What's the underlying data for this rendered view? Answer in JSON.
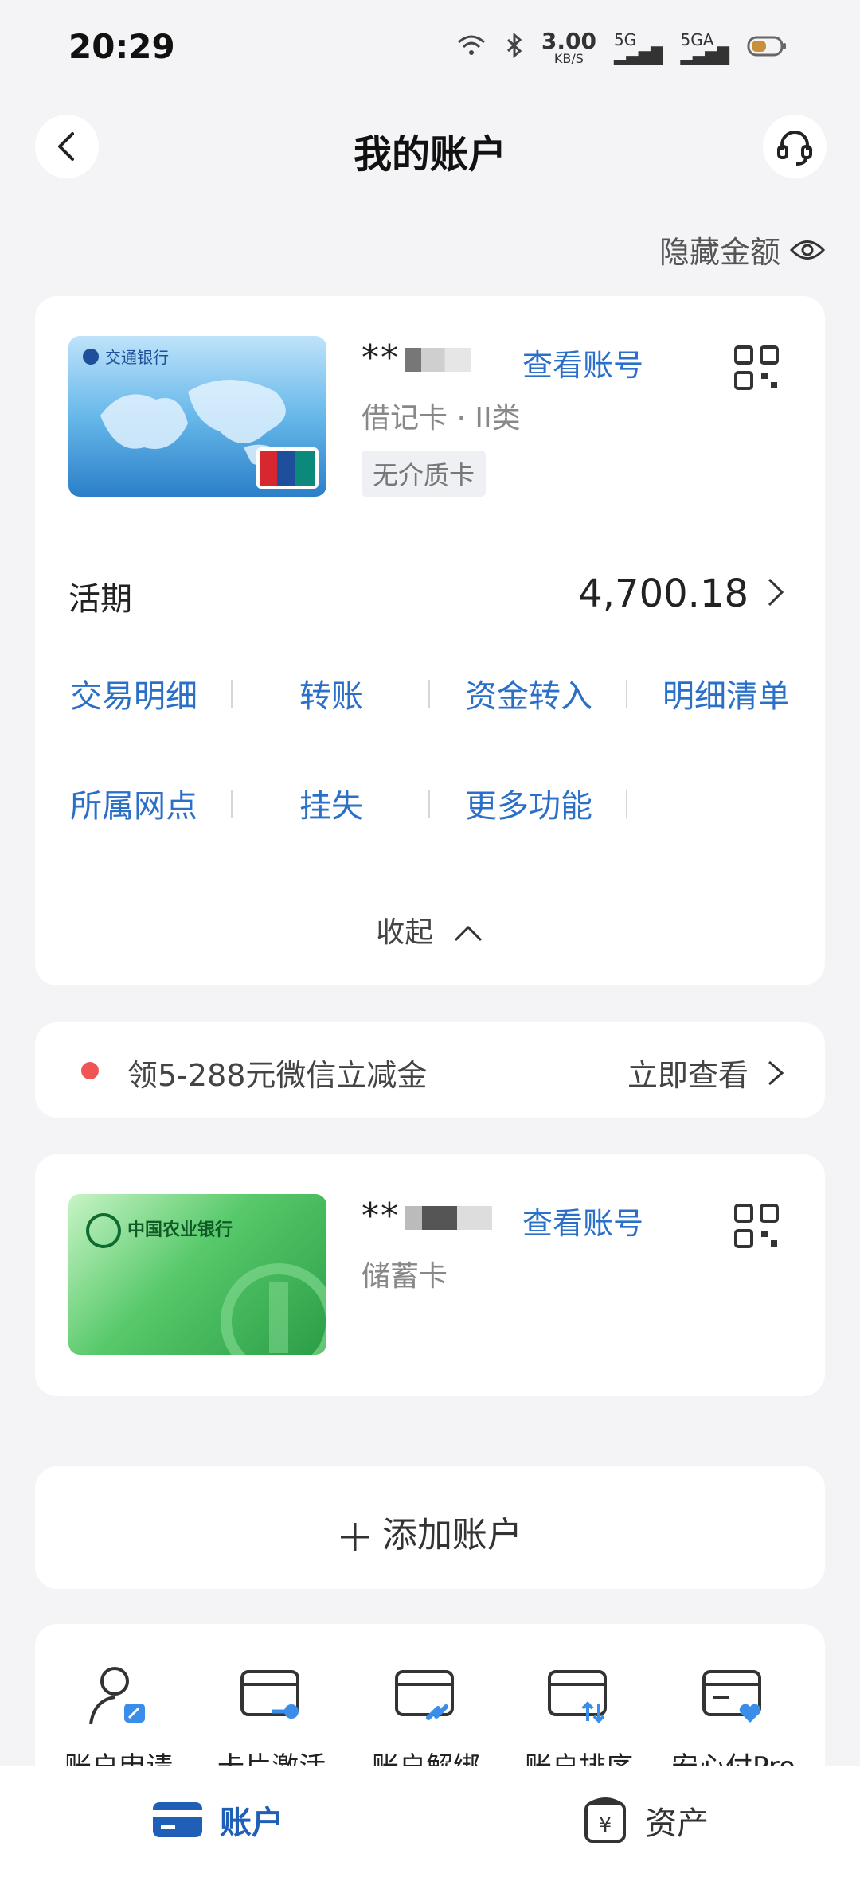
{
  "status_bar": {
    "time": "20:29",
    "net_speed": "3.00",
    "net_unit": "KB/S",
    "sig1": "5G",
    "sig2": "5GA"
  },
  "header": {
    "title": "我的账户",
    "hide_amount_label": "隐藏金额"
  },
  "account1": {
    "masked_no": "**",
    "view_number": "查看账号",
    "type": "借记卡 · II类",
    "tag": "无介质卡",
    "balance_label": "活期",
    "balance": "4,700.18",
    "actions": [
      "交易明细",
      "转账",
      "资金转入",
      "明细清单",
      "所属网点",
      "挂失",
      "更多功能"
    ],
    "collapse": "收起",
    "card_bank_name": "交通银行"
  },
  "promo": {
    "text": "领5-288元微信立减金",
    "link": "立即查看"
  },
  "account2": {
    "masked_no": "**",
    "view_number": "查看账号",
    "type": "储蓄卡",
    "card_bank_name": "中国农业银行"
  },
  "add_account": {
    "label": "添加账户"
  },
  "tools": [
    {
      "label": "账户申请",
      "icon": "user-edit-icon"
    },
    {
      "label": "卡片激活",
      "icon": "card-key-icon"
    },
    {
      "label": "账户解绑",
      "icon": "card-unlink-icon"
    },
    {
      "label": "账户排序",
      "icon": "card-sort-icon"
    },
    {
      "label": "安心付Pro",
      "icon": "card-heart-icon"
    }
  ],
  "bottom_nav": {
    "accounts": "账户",
    "assets": "资产"
  },
  "colors": {
    "accent": "#2a6fc8",
    "nav_active": "#1f5fb8",
    "background": "#f4f4f6",
    "promo_dot": "#f05454"
  }
}
